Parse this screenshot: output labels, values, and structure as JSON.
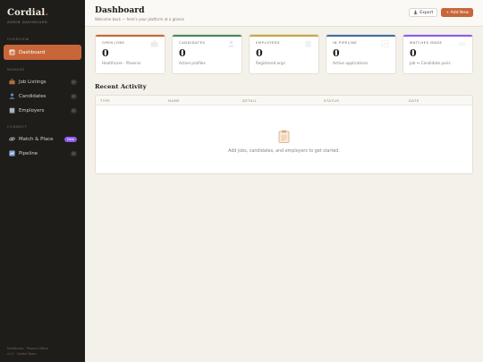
{
  "brand": {
    "name": "Cordial",
    "dot": ".",
    "subtitle": "Admin Dashboard"
  },
  "sidebar": {
    "sections": {
      "overview": "Overview",
      "manage": "Manage",
      "connect": "Connect"
    },
    "items": [
      {
        "label": "Dashboard",
        "icon": "chart-icon"
      },
      {
        "label": "Job Listings",
        "count": "0",
        "icon": "briefcase-icon"
      },
      {
        "label": "Candidates",
        "count": "0",
        "icon": "person-icon"
      },
      {
        "label": "Employers",
        "count": "0",
        "icon": "building-icon"
      },
      {
        "label": "Match & Place",
        "badge": "New",
        "icon": "link-icon"
      },
      {
        "label": "Pipeline",
        "count": "0",
        "icon": "pipeline-icon"
      }
    ],
    "footer": {
      "line1": "Healthcare · Phoenix Metro",
      "line2": "v1.0 · Cordial Team"
    }
  },
  "header": {
    "title": "Dashboard",
    "subtitle": "Welcome back — here's your platform at a glance",
    "export_label": "Export",
    "add_label": "+ Add New"
  },
  "stats": [
    {
      "label": "Open Jobs",
      "value": "0",
      "note": "Healthcare · Phoenix",
      "color": "#c8663a"
    },
    {
      "label": "Candidates",
      "value": "0",
      "note": "Active profiles",
      "color": "#3f8a5a"
    },
    {
      "label": "Employers",
      "value": "0",
      "note": "Registered orgs",
      "color": "#c9a640"
    },
    {
      "label": "In Pipeline",
      "value": "0",
      "note": "Active applications",
      "color": "#3e6ea3"
    },
    {
      "label": "Matches Made",
      "value": "0",
      "note": "Job ↔ Candidate pairs",
      "color": "#8a5cf0"
    }
  ],
  "recent": {
    "title": "Recent Activity",
    "columns": [
      "Type",
      "Name",
      "Detail",
      "Status",
      "Date"
    ],
    "empty_text": "Add jobs, candidates, and employers to get started."
  }
}
